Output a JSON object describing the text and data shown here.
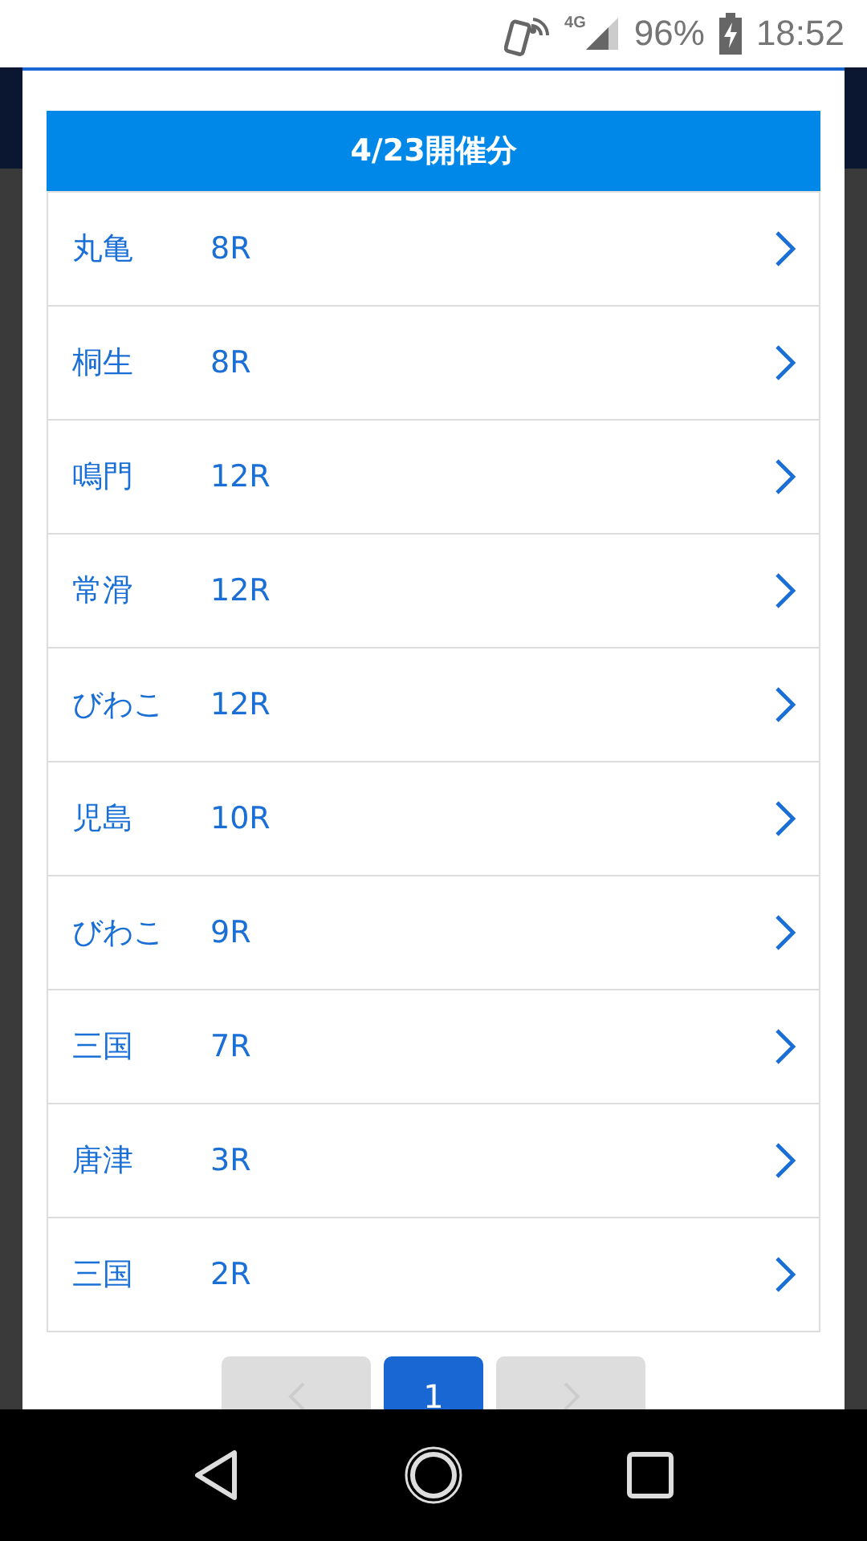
{
  "status_bar": {
    "network": "4G",
    "battery": "96%",
    "time": "18:52"
  },
  "list": {
    "title": "4/23開催分",
    "rows": [
      {
        "venue": "丸亀",
        "race": "8R"
      },
      {
        "venue": "桐生",
        "race": "8R"
      },
      {
        "venue": "鳴門",
        "race": "12R"
      },
      {
        "venue": "常滑",
        "race": "12R"
      },
      {
        "venue": "びわこ",
        "race": "12R"
      },
      {
        "venue": "児島",
        "race": "10R"
      },
      {
        "venue": "びわこ",
        "race": "9R"
      },
      {
        "venue": "三国",
        "race": "7R"
      },
      {
        "venue": "唐津",
        "race": "3R"
      },
      {
        "venue": "三国",
        "race": "2R"
      }
    ]
  },
  "pagination": {
    "prev_disabled": true,
    "next_disabled": true,
    "pages": [
      {
        "label": "1",
        "selected": true
      }
    ]
  }
}
